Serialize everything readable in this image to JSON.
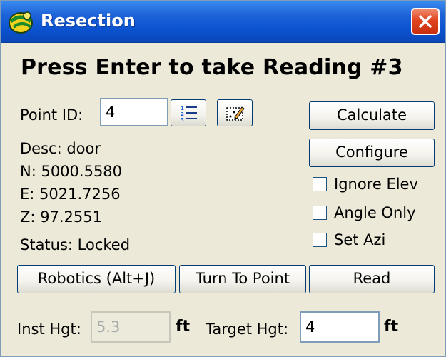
{
  "window": {
    "title": "Resection"
  },
  "heading": "Press Enter to take Reading #3",
  "point": {
    "label": "Point ID:",
    "value": "4",
    "list_icon": "list-icon",
    "map_icon": "map-select-icon"
  },
  "info": {
    "desc": "Desc: door",
    "north": "N: 5000.5580",
    "east": "E: 5021.7256",
    "z": "Z: 97.2551",
    "status": "Status: Locked"
  },
  "buttons": {
    "calculate": "Calculate",
    "configure": "Configure",
    "robotics": "Robotics (Alt+J)",
    "turn_to_point": "Turn To Point",
    "read": "Read"
  },
  "options": {
    "ignore_elev": {
      "label": "Ignore Elev",
      "checked": false
    },
    "angle_only": {
      "label": "Angle Only",
      "checked": false
    },
    "set_azi": {
      "label": "Set Azi",
      "checked": false
    }
  },
  "instrument": {
    "inst_hgt_label": "Inst Hgt:",
    "inst_hgt_value": "5.3",
    "inst_unit": "ft",
    "target_hgt_label": "Target Hgt:",
    "target_hgt_value": "4",
    "target_unit": "ft"
  },
  "colors": {
    "titlebar": "#0b52d0",
    "close": "#e0451f",
    "dialog_bg": "#ece9d8"
  }
}
